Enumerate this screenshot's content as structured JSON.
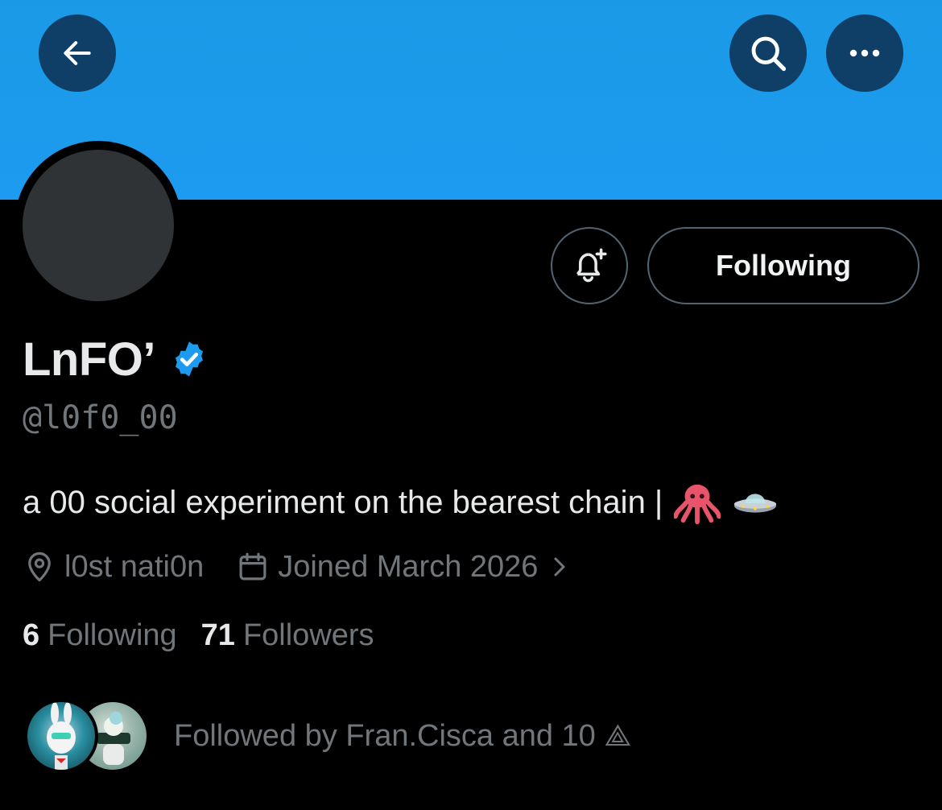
{
  "header": {
    "back_label": "Back",
    "search_label": "Search",
    "more_label": "More"
  },
  "profile": {
    "display_name": "LnFO’",
    "handle": "@l0f0_00",
    "bio": "a 00 social experiment on the bearest chain |",
    "bio_emojis": [
      "octopus-emoji",
      "flying-saucer-emoji"
    ],
    "location": "l0st nati0n",
    "joined": "Joined March 2026",
    "following_count": "6",
    "following_label": "Following",
    "followers_count": "71",
    "followers_label": "Followers",
    "followed_by": "Followed by Fran.Cisca and 10 ⟁"
  },
  "actions": {
    "follow_button_label": "Following",
    "notifications_label": "Turn on notifications"
  },
  "icons": {
    "back": "arrow-left-icon",
    "search": "search-icon",
    "more": "more-horizontal-icon",
    "bell": "bell-plus-icon",
    "verified": "verified-badge-icon",
    "location": "location-pin-icon",
    "calendar": "calendar-icon",
    "chevron": "chevron-right-icon"
  },
  "colors": {
    "banner": "#1d9bf0",
    "verified_badge": "#1d9bf0",
    "background": "#000000",
    "secondary_text": "#71767b"
  }
}
